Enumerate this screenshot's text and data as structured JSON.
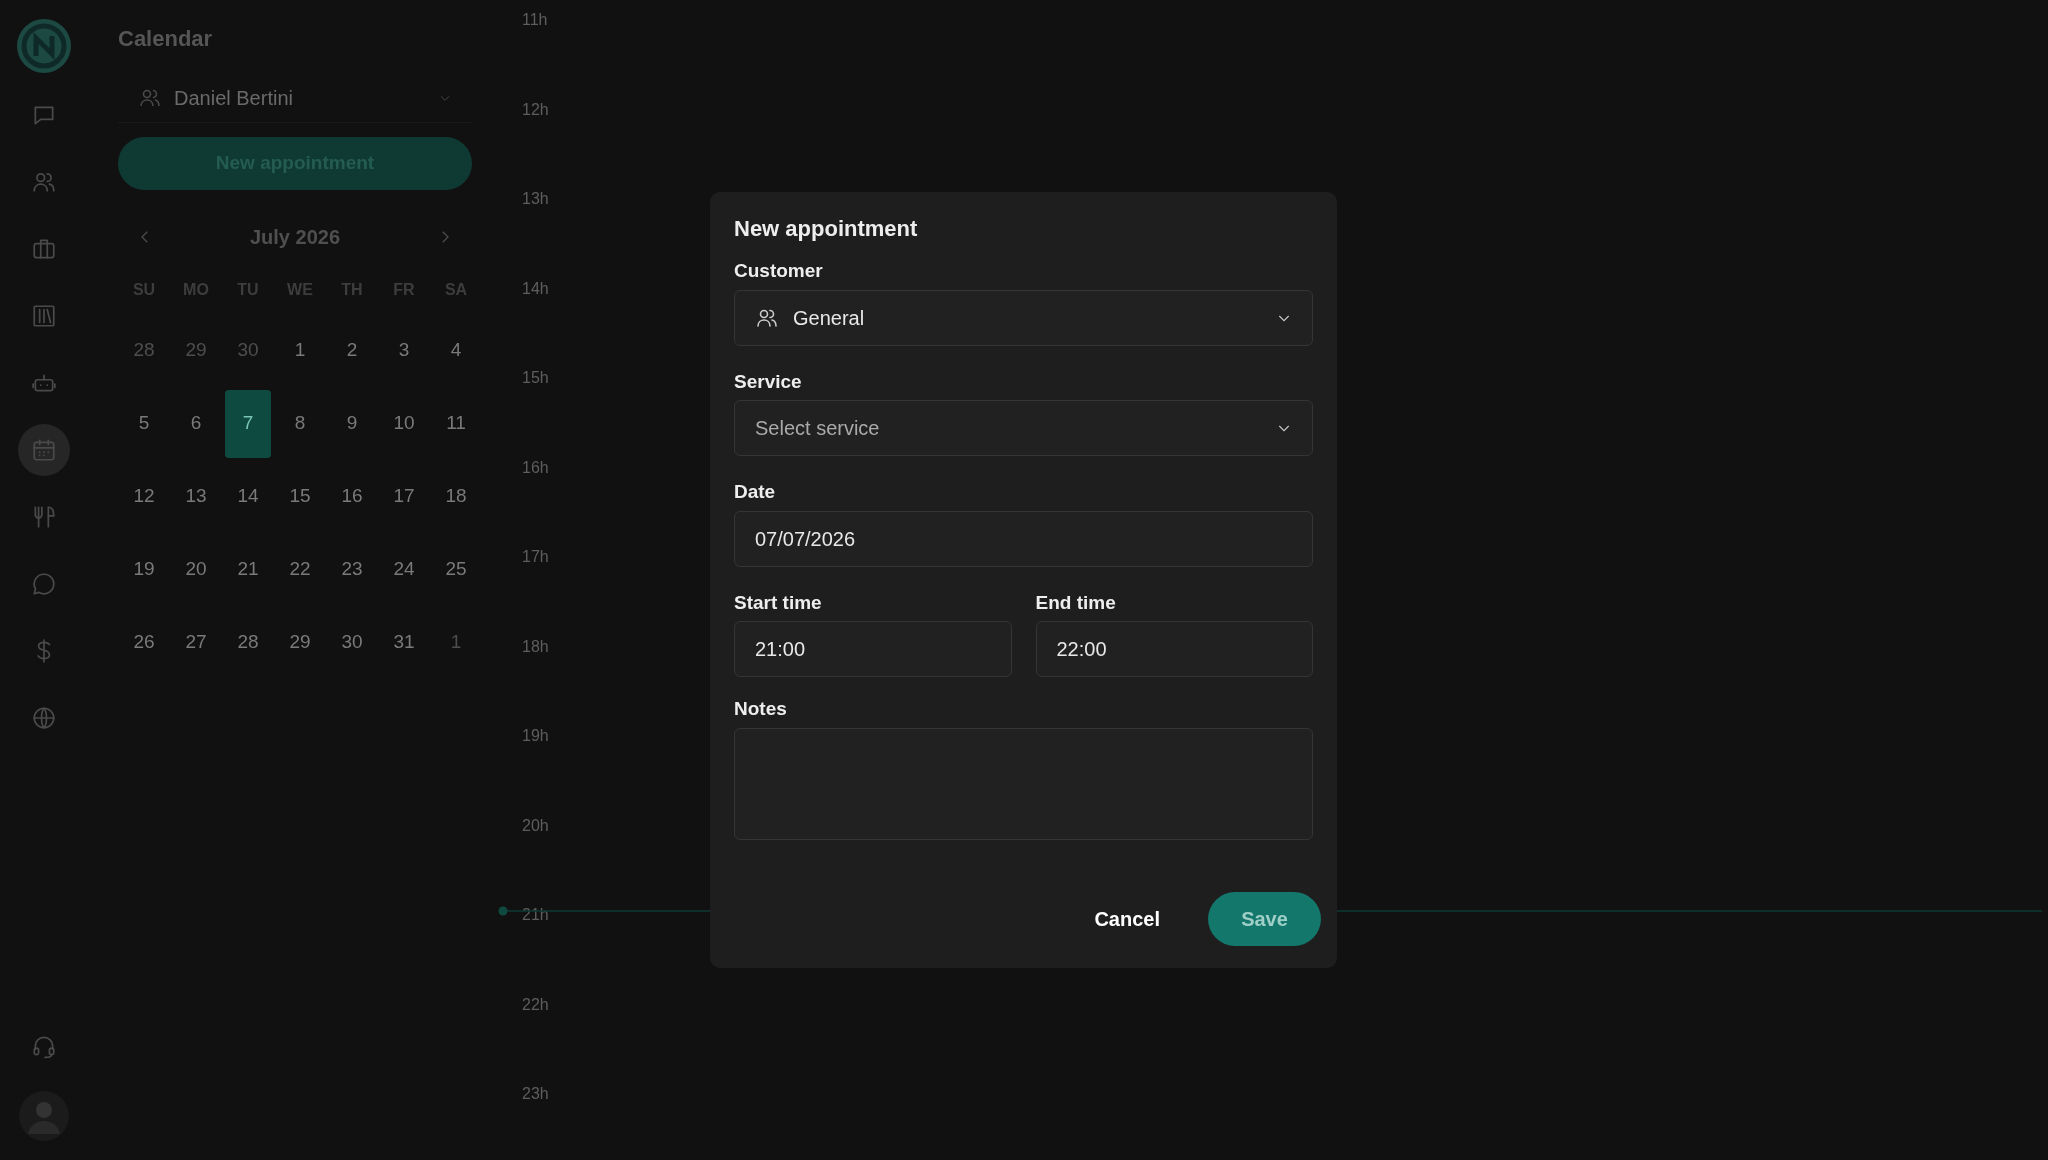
{
  "nav": {
    "items": [
      {
        "kind": "messages",
        "selected": false
      },
      {
        "kind": "contacts",
        "selected": false
      },
      {
        "kind": "briefcase",
        "selected": false
      },
      {
        "kind": "books",
        "selected": false
      },
      {
        "kind": "robot",
        "selected": false
      },
      {
        "kind": "calendar",
        "selected": true
      },
      {
        "kind": "cutlery",
        "selected": false
      },
      {
        "kind": "chat",
        "selected": false
      },
      {
        "kind": "dollar",
        "selected": false
      },
      {
        "kind": "globe",
        "selected": false
      }
    ],
    "bottom": [
      {
        "kind": "headset"
      },
      {
        "kind": "avatar"
      }
    ]
  },
  "calendar": {
    "title": "Calendar",
    "user_select": {
      "value": "Daniel Bertini"
    },
    "new_button": "New appointment",
    "month": "July 2026",
    "weekdays": [
      "SU",
      "MO",
      "TU",
      "WE",
      "TH",
      "FR",
      "SA"
    ],
    "days": [
      {
        "label": "28",
        "muted": true,
        "selected": false
      },
      {
        "label": "29",
        "muted": true,
        "selected": false
      },
      {
        "label": "30",
        "muted": true,
        "selected": false
      },
      {
        "label": "1",
        "muted": false,
        "selected": false
      },
      {
        "label": "2",
        "muted": false,
        "selected": false
      },
      {
        "label": "3",
        "muted": false,
        "selected": false
      },
      {
        "label": "4",
        "muted": false,
        "selected": false
      },
      {
        "label": "5",
        "muted": false,
        "selected": false
      },
      {
        "label": "6",
        "muted": false,
        "selected": false
      },
      {
        "label": "7",
        "muted": false,
        "selected": true
      },
      {
        "label": "8",
        "muted": false,
        "selected": false
      },
      {
        "label": "9",
        "muted": false,
        "selected": false
      },
      {
        "label": "10",
        "muted": false,
        "selected": false
      },
      {
        "label": "11",
        "muted": false,
        "selected": false
      },
      {
        "label": "12",
        "muted": false,
        "selected": false
      },
      {
        "label": "13",
        "muted": false,
        "selected": false
      },
      {
        "label": "14",
        "muted": false,
        "selected": false
      },
      {
        "label": "15",
        "muted": false,
        "selected": false
      },
      {
        "label": "16",
        "muted": false,
        "selected": false
      },
      {
        "label": "17",
        "muted": false,
        "selected": false
      },
      {
        "label": "18",
        "muted": false,
        "selected": false
      },
      {
        "label": "19",
        "muted": false,
        "selected": false
      },
      {
        "label": "20",
        "muted": false,
        "selected": false
      },
      {
        "label": "21",
        "muted": false,
        "selected": false
      },
      {
        "label": "22",
        "muted": false,
        "selected": false
      },
      {
        "label": "23",
        "muted": false,
        "selected": false
      },
      {
        "label": "24",
        "muted": false,
        "selected": false
      },
      {
        "label": "25",
        "muted": false,
        "selected": false
      },
      {
        "label": "26",
        "muted": false,
        "selected": false
      },
      {
        "label": "27",
        "muted": false,
        "selected": false
      },
      {
        "label": "28",
        "muted": false,
        "selected": false
      },
      {
        "label": "29",
        "muted": false,
        "selected": false
      },
      {
        "label": "30",
        "muted": false,
        "selected": false
      },
      {
        "label": "31",
        "muted": false,
        "selected": false
      },
      {
        "label": "1",
        "muted": true,
        "selected": false
      }
    ]
  },
  "timeline": {
    "hours": [
      {
        "label": "11h",
        "current": false
      },
      {
        "label": "12h",
        "current": false
      },
      {
        "label": "13h",
        "current": false
      },
      {
        "label": "14h",
        "current": false
      },
      {
        "label": "15h",
        "current": false
      },
      {
        "label": "16h",
        "current": false
      },
      {
        "label": "17h",
        "current": false
      },
      {
        "label": "18h",
        "current": false
      },
      {
        "label": "19h",
        "current": false
      },
      {
        "label": "20h",
        "current": false
      },
      {
        "label": "21h",
        "current": true
      },
      {
        "label": "22h",
        "current": false
      },
      {
        "label": "23h",
        "current": false
      }
    ]
  },
  "modal": {
    "title": "New appointment",
    "fields": [
      {
        "kind": "select",
        "label": "Customer",
        "value": "General",
        "icon": true
      },
      {
        "kind": "select",
        "label": "Service",
        "placeholder": "Select service"
      },
      {
        "kind": "input",
        "label": "Date",
        "value": "07/07/2026"
      },
      {
        "kind": "input",
        "label": "Start time",
        "value": "21:00",
        "half": true
      },
      {
        "kind": "input",
        "label": "End time",
        "value": "22:00",
        "half": true
      },
      {
        "kind": "textarea",
        "label": "Notes"
      }
    ],
    "buttons": [
      {
        "label": "Cancel",
        "kind": "text"
      },
      {
        "label": "Save",
        "kind": "primary"
      }
    ]
  }
}
